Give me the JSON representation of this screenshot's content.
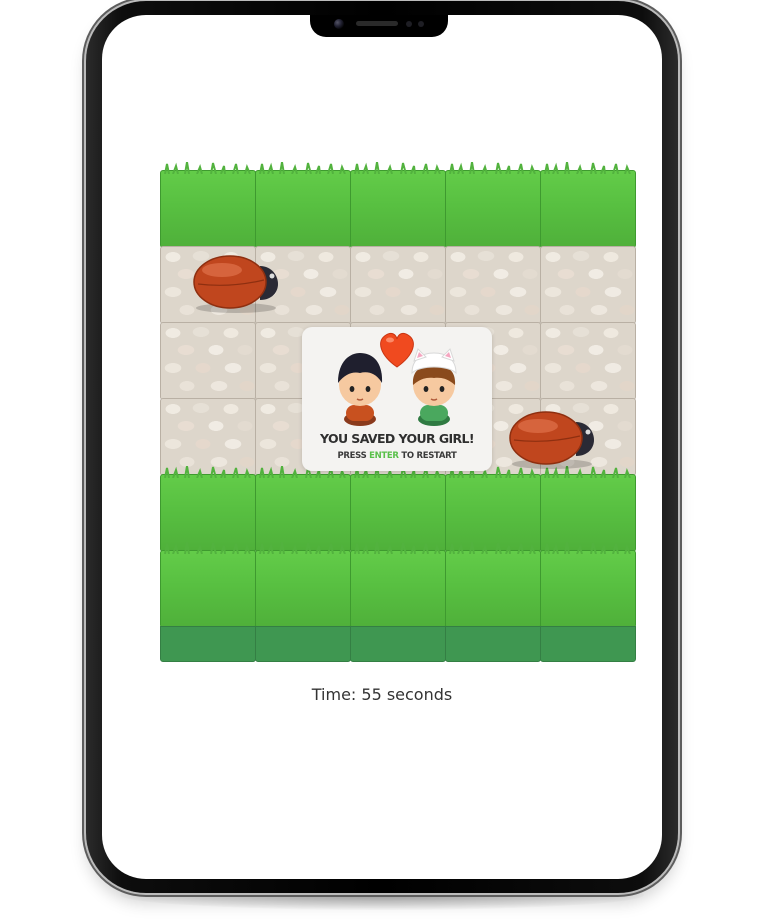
{
  "game": {
    "grid": {
      "columns": 5,
      "rows": [
        {
          "type": "grass",
          "label": "grass-row-1"
        },
        {
          "type": "stone",
          "label": "stone-row-1"
        },
        {
          "type": "stone",
          "label": "stone-row-2"
        },
        {
          "type": "stone",
          "label": "stone-row-3"
        },
        {
          "type": "grass",
          "label": "grass-row-2"
        },
        {
          "type": "grass",
          "label": "grass-row-3"
        }
      ]
    },
    "enemies": [
      {
        "name": "ladybug-enemy",
        "icon": "bug-icon",
        "facing": "right"
      },
      {
        "name": "ladybug-enemy",
        "icon": "bug-icon",
        "facing": "right"
      }
    ],
    "win_screen": {
      "title": "YOU SAVED YOUR GIRL!",
      "subtitle_prefix": "PRESS",
      "subtitle_key": "ENTER",
      "subtitle_suffix": "TO RESTART",
      "icons": [
        "boy-character-icon",
        "heart-icon",
        "girl-character-icon"
      ],
      "accent_color": "#59c04a"
    },
    "timer_text": "Time: 55 seconds"
  },
  "colors": {
    "grass": "#58c041",
    "stone": "#ddd6cb",
    "bug_shell": "#c0461e",
    "heart": "#f04a1f"
  }
}
